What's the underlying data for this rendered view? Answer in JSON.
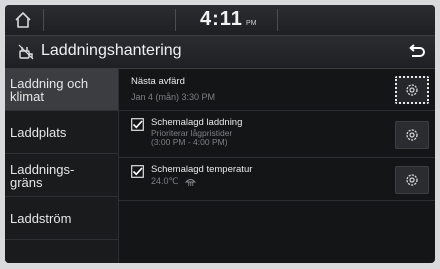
{
  "status_bar": {
    "time": "4:11",
    "ampm": "PM"
  },
  "header": {
    "title": "Laddningshantering"
  },
  "sidebar": {
    "items": [
      {
        "line1": "Laddning och",
        "line2": "klimat",
        "active": true
      },
      {
        "line1": "Laddplats",
        "line2": "",
        "active": false
      },
      {
        "line1": "Laddnings-",
        "line2": "gräns",
        "active": false
      },
      {
        "line1": "Laddström",
        "line2": "",
        "active": false
      }
    ]
  },
  "main": {
    "next_departure": {
      "label": "Nästa avfärd",
      "value": "Jan 4 (mån) 3:30 PM"
    },
    "scheduled_charging": {
      "label": "Schemalagd laddning",
      "sub1": "Prioriterar lågpristider",
      "sub2": "(3:00 PM - 4:00 PM)",
      "checked": true
    },
    "scheduled_temperature": {
      "label": "Schemalagd temperatur",
      "value": "24.0℃",
      "checked": true
    }
  },
  "icons": {
    "home": "home-icon",
    "charging": "charging-icon",
    "back": "back-arrow-icon",
    "gear": "gear-icon",
    "checkbox": "checkbox-checked-icon",
    "heater": "defrost-icon"
  },
  "colors": {
    "background": "#141517",
    "active": "#3b3d41",
    "text": "#e8e8e8",
    "muted": "#7d7f82"
  }
}
